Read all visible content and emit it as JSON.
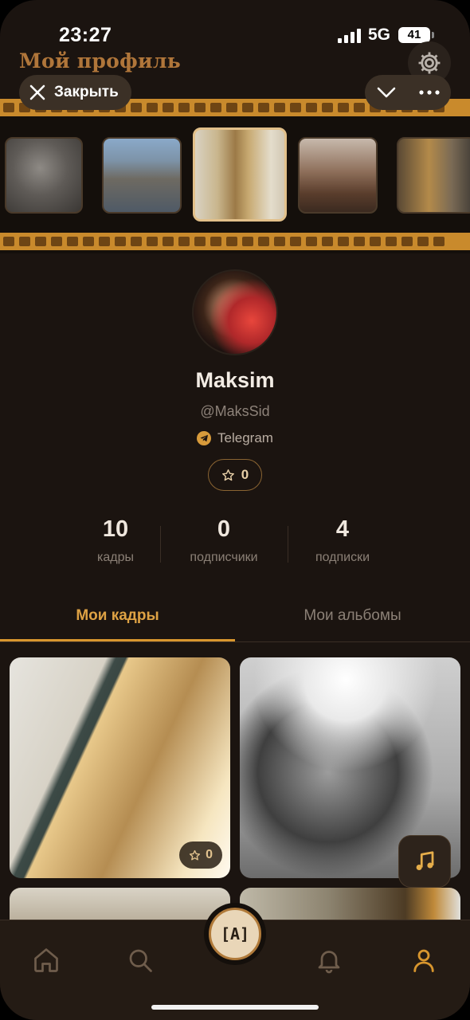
{
  "status_bar": {
    "time": "23:27",
    "network": "5G",
    "battery": "41"
  },
  "header": {
    "title": "Мой профиль",
    "close_label": "Закрыть"
  },
  "profile": {
    "name": "Maksim",
    "username": "@MaksSid",
    "telegram_label": "Telegram",
    "stars": "0"
  },
  "stats": [
    {
      "value": "10",
      "label": "кадры"
    },
    {
      "value": "0",
      "label": "подписчики"
    },
    {
      "value": "4",
      "label": "подписки"
    }
  ],
  "tabs": [
    {
      "label": "Мои кадры",
      "active": true
    },
    {
      "label": "Мои альбомы",
      "active": false
    }
  ],
  "cards": [
    {
      "stars": "0"
    }
  ],
  "center_button_label": "[A]",
  "colors": {
    "accent": "#dea244",
    "background": "#1b1410",
    "film": "#c98a2c"
  },
  "icons": [
    "gear-icon",
    "close-icon",
    "chevron-down-icon",
    "more-icon",
    "star-icon",
    "telegram-icon",
    "music-note-icon",
    "home-icon",
    "search-icon",
    "bell-icon",
    "user-icon"
  ]
}
